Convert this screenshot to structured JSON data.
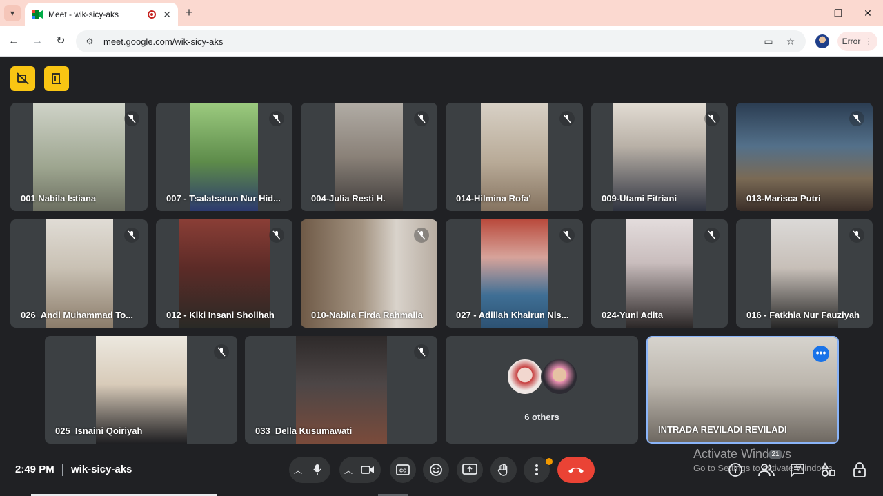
{
  "browser": {
    "tab_title": "Meet - wik-sicy-aks",
    "url": "meet.google.com/wik-sicy-aks",
    "status_chip": "Error"
  },
  "tiles": [
    {
      "name": "001 Nabila Istiana",
      "bg": "#d9dbd4"
    },
    {
      "name": "007 - Tsalatsatun Nur Hid...",
      "bg": "#7fae5e"
    },
    {
      "name": "004-Julia Resti H.",
      "bg": "#a39d94"
    },
    {
      "name": "014-Hilmina Rofa'",
      "bg": "#c9c1b5"
    },
    {
      "name": "009-Utami Fitriani",
      "bg": "#d4ccc2"
    },
    {
      "name": "013-Marisca Putri",
      "bg": "#4f6a7d"
    },
    {
      "name": "026_Andi Muhammad To...",
      "bg": "#c8c3b9"
    },
    {
      "name": "012 - Kiki Insani Sholihah",
      "bg": "#7a3c36"
    },
    {
      "name": "010-Nabila Firda Rahmalia",
      "bg": "#b8aa99"
    },
    {
      "name": "027 - Adillah Khairun Nis...",
      "bg": "#b95b52"
    },
    {
      "name": "024-Yuni Adita",
      "bg": "#dcd5d2"
    },
    {
      "name": "016 - Fatkhia Nur Fauziyah",
      "bg": "#d8d6d4"
    },
    {
      "name": "025_Isnaini Qoiriyah",
      "bg": "#e4dfd5"
    },
    {
      "name": "033_Della Kusumawati",
      "bg": "#4d4646"
    }
  ],
  "others": {
    "label": "6 others"
  },
  "self_tile": {
    "name": "INTRADA REVILADI REVILADI"
  },
  "bottom": {
    "time": "2:49 PM",
    "meeting_code": "wik-sicy-aks",
    "people_count": "21"
  },
  "watermark": {
    "line1": "Activate Windows",
    "line2": "Go to Settings to activate Windows."
  },
  "colors": {
    "accent_yellow": "#f9c513",
    "end_call_red": "#ea4335",
    "active_border": "#8ab4f8"
  }
}
